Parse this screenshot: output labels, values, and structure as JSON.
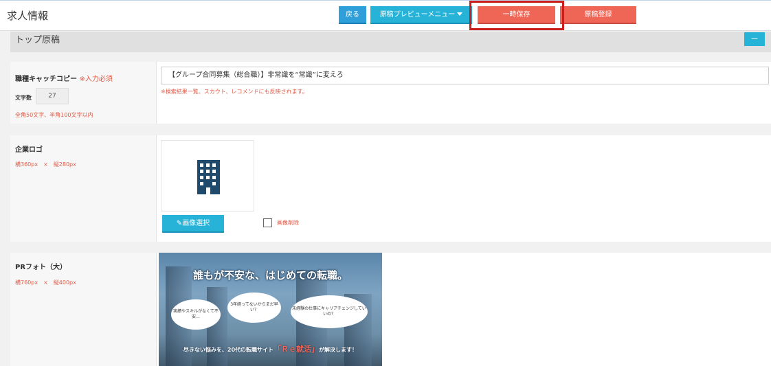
{
  "header": {
    "title": "求人情報",
    "back_label": "戻る",
    "preview_menu_label": "原稿プレビューメニュー",
    "temp_save_label": "一時保存",
    "register_label": "原稿登録"
  },
  "section": {
    "title": "トップ原稿",
    "collapse_label": "－"
  },
  "catch_copy": {
    "label": "職種キャッチコピー",
    "required": "※入力必須",
    "char_count_label": "文字数",
    "char_count": "27",
    "limit_note": "全角50文字、半角100文字以内",
    "value": "【グループ合同募集（総合職）】非常識を“常識”に変えろ",
    "help": "※検索結果一覧、スカウト、レコメンドにも反映されます。"
  },
  "company_logo": {
    "label": "企業ロゴ",
    "size_note": "横360px　×　縦280px",
    "select_label": "画像選択",
    "delete_label": "画像削除"
  },
  "pr_photo": {
    "label": "PRフォト（大）",
    "size_note": "横760px　×　縦400px",
    "headline": "誰もが不安な、はじめての転職。",
    "bubble1": "実績やスキルがなくて不安…",
    "bubble2": "3年経ってないからまだ早い？",
    "bubble3": "未経験の仕事にキャリアチェンジしていいの？",
    "bottom_pre": "尽きない悩みを、20代の転職サイト",
    "bottom_brand": "「Ｒｅ就活」",
    "bottom_post": "が解決します！"
  },
  "colors": {
    "accent_blue": "#27b3d8",
    "save_red": "#f06656",
    "highlight": "#cc1d1d",
    "required_red": "#e05a45"
  }
}
